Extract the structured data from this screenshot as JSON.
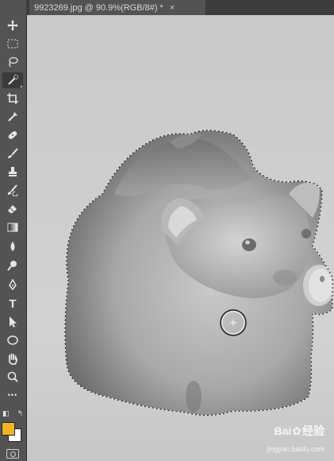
{
  "document_tab": {
    "title": "9923269.jpg @ 90.9%(RGB/8#) *",
    "close_glyph": "×"
  },
  "toolbar": {
    "tools": [
      {
        "name": "move-tool-icon"
      },
      {
        "name": "marquee-tool-icon"
      },
      {
        "name": "lasso-tool-icon"
      },
      {
        "name": "quick-selection-tool-icon",
        "active": true
      },
      {
        "name": "crop-tool-icon"
      },
      {
        "name": "eyedropper-tool-icon"
      },
      {
        "name": "healing-brush-tool-icon"
      },
      {
        "name": "brush-tool-icon"
      },
      {
        "name": "clone-stamp-tool-icon"
      },
      {
        "name": "history-brush-tool-icon"
      },
      {
        "name": "eraser-tool-icon"
      },
      {
        "name": "gradient-tool-icon"
      },
      {
        "name": "blur-tool-icon"
      },
      {
        "name": "dodge-tool-icon"
      },
      {
        "name": "pen-tool-icon"
      },
      {
        "name": "type-tool-icon",
        "glyph": "T"
      },
      {
        "name": "path-selection-tool-icon"
      },
      {
        "name": "ellipse-tool-icon"
      },
      {
        "name": "hand-tool-icon"
      },
      {
        "name": "zoom-tool-icon"
      },
      {
        "name": "more-tools-icon",
        "glyph": "•••"
      }
    ],
    "foreground_color": "#f0b323",
    "background_color": "#ffffff"
  },
  "watermark": {
    "brand_left": "Bai",
    "brand_right": "经验",
    "url": "jingyan.baidu.com"
  }
}
